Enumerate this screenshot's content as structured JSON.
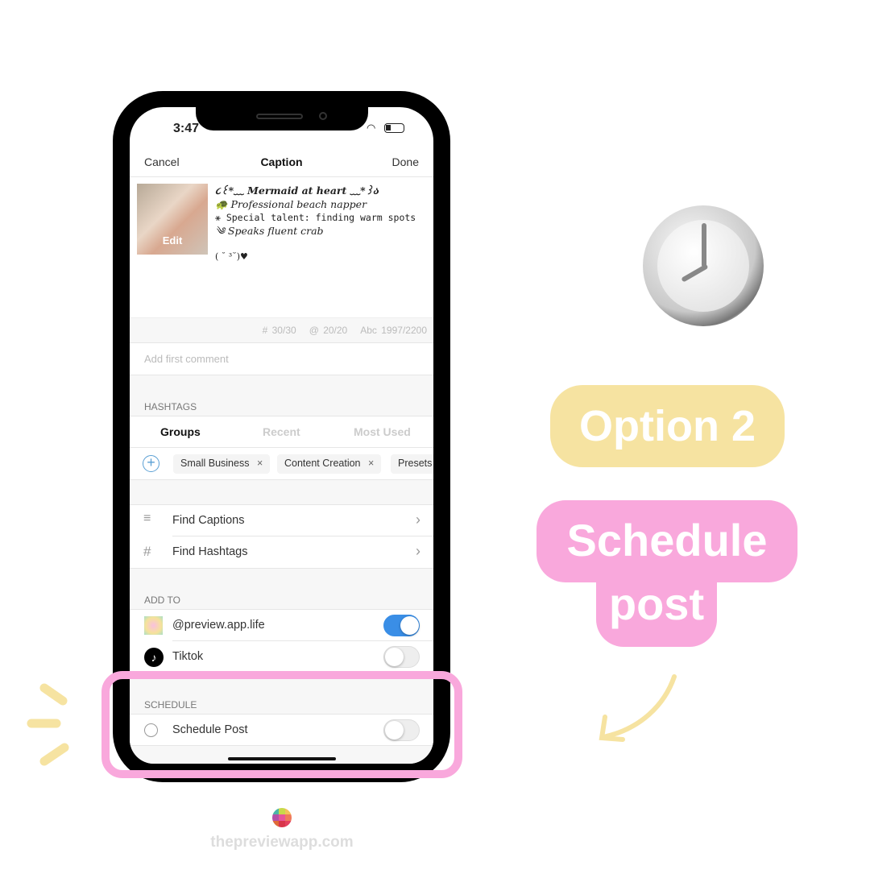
{
  "status": {
    "time": "3:47"
  },
  "nav": {
    "cancel": "Cancel",
    "title": "Caption",
    "done": "Done"
  },
  "post": {
    "edit_label": "Edit",
    "caption_lines": [
      "૮꒰*﹏ Mermaid at heart ﹏*꒱ა",
      "🐢 Professional beach napper",
      "⚹ Special talent: finding warm spots",
      "༄ Speaks fluent crab",
      "",
      "( ˘ ³˘)♥"
    ]
  },
  "counters": {
    "hashtags": "# 30/30",
    "mentions": "@ 20/20",
    "chars": "Abc 1997/2200"
  },
  "comment": {
    "placeholder": "Add first comment"
  },
  "hashtags": {
    "label": "HASHTAGS",
    "tabs": [
      "Groups",
      "Recent",
      "Most Used"
    ],
    "chips": [
      "Small Business",
      "Content Creation",
      "Presets"
    ]
  },
  "links": [
    {
      "label": "Find Captions",
      "icon": "lines-icon"
    },
    {
      "label": "Find Hashtags",
      "icon": "hash-icon"
    }
  ],
  "add_to": {
    "label": "ADD TO",
    "accounts": [
      {
        "name": "@preview.app.life",
        "on": true
      },
      {
        "name": "Tiktok",
        "on": false
      }
    ]
  },
  "schedule": {
    "label": "SCHEDULE",
    "item": "Schedule Post",
    "on": false
  },
  "promo": {
    "option": "Option 2",
    "headline_1": "Schedule",
    "headline_2": "post",
    "site": "thepreviewapp.com"
  },
  "colors": {
    "pink": "#f9a8dc",
    "yellow": "#f6e3a1",
    "toggle_on": "#3a8ee6"
  }
}
